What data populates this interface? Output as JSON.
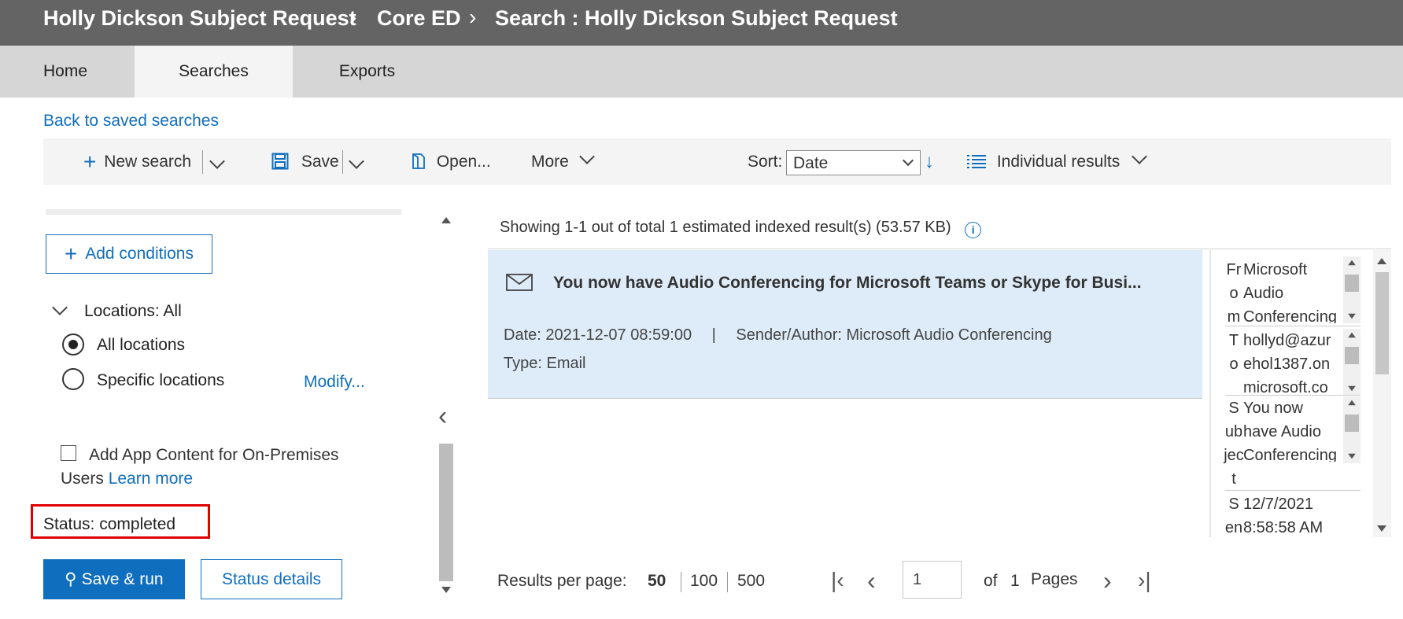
{
  "header": {
    "crumbs": [
      "Holly Dickson Subject Request",
      "Core ED",
      "Search : Holly Dickson Subject Request"
    ]
  },
  "tabs": [
    "Home",
    "Searches",
    "Exports"
  ],
  "back_link": "Back to saved searches",
  "toolbar": {
    "new_search": "New search",
    "save": "Save",
    "open": "Open...",
    "more": "More",
    "sort_label": "Sort:",
    "sort_value": "Date",
    "view": "Individual results"
  },
  "left": {
    "add_conditions": "Add conditions",
    "locations_label": "Locations:",
    "locations_value": "All",
    "all_locations": "All locations",
    "specific_locations": "Specific locations",
    "modify": "Modify...",
    "app_content_line1": "Add App Content for On-Premises",
    "app_content_line2": "Users",
    "learn_more": "Learn more",
    "status_label": "Status:",
    "status_value": "completed",
    "save_run": "Save & run",
    "status_details": "Status details"
  },
  "results": {
    "summary": "Showing 1-1 out of total 1 estimated indexed result(s) (53.57 KB)",
    "item": {
      "subject": "You now have Audio Conferencing for Microsoft Teams or Skype for Busi...",
      "date": "Date: 2021-12-07 08:59:00",
      "divider": "|",
      "sender": "Sender/Author: Microsoft Audio Conferencing",
      "type": "Type: Email"
    }
  },
  "details": {
    "from_label": [
      "Fr",
      "o",
      "m"
    ],
    "from_value": [
      "Microsoft",
      "Audio",
      "Conferencing"
    ],
    "to_label": [
      "T",
      "o"
    ],
    "to_value": [
      "hollyd@azur",
      "ehol1387.on",
      "microsoft.co"
    ],
    "subject_label": [
      "S",
      "ub",
      "jec",
      "t"
    ],
    "subject_value": [
      "You now",
      "have Audio",
      "Conferencing"
    ],
    "sent_label": [
      "S",
      "en"
    ],
    "sent_value": [
      "12/7/2021",
      "8:58:58 AM"
    ]
  },
  "pager": {
    "per_page_label": "Results per page:",
    "options": [
      "50",
      "100",
      "500"
    ],
    "page_value": "1",
    "of": "of",
    "total": "1",
    "pages": "Pages"
  },
  "colors": {
    "accent": "#106ebe",
    "highlight_box": "#e00000",
    "selected_row": "#deecf9",
    "header_bg": "#646464"
  }
}
